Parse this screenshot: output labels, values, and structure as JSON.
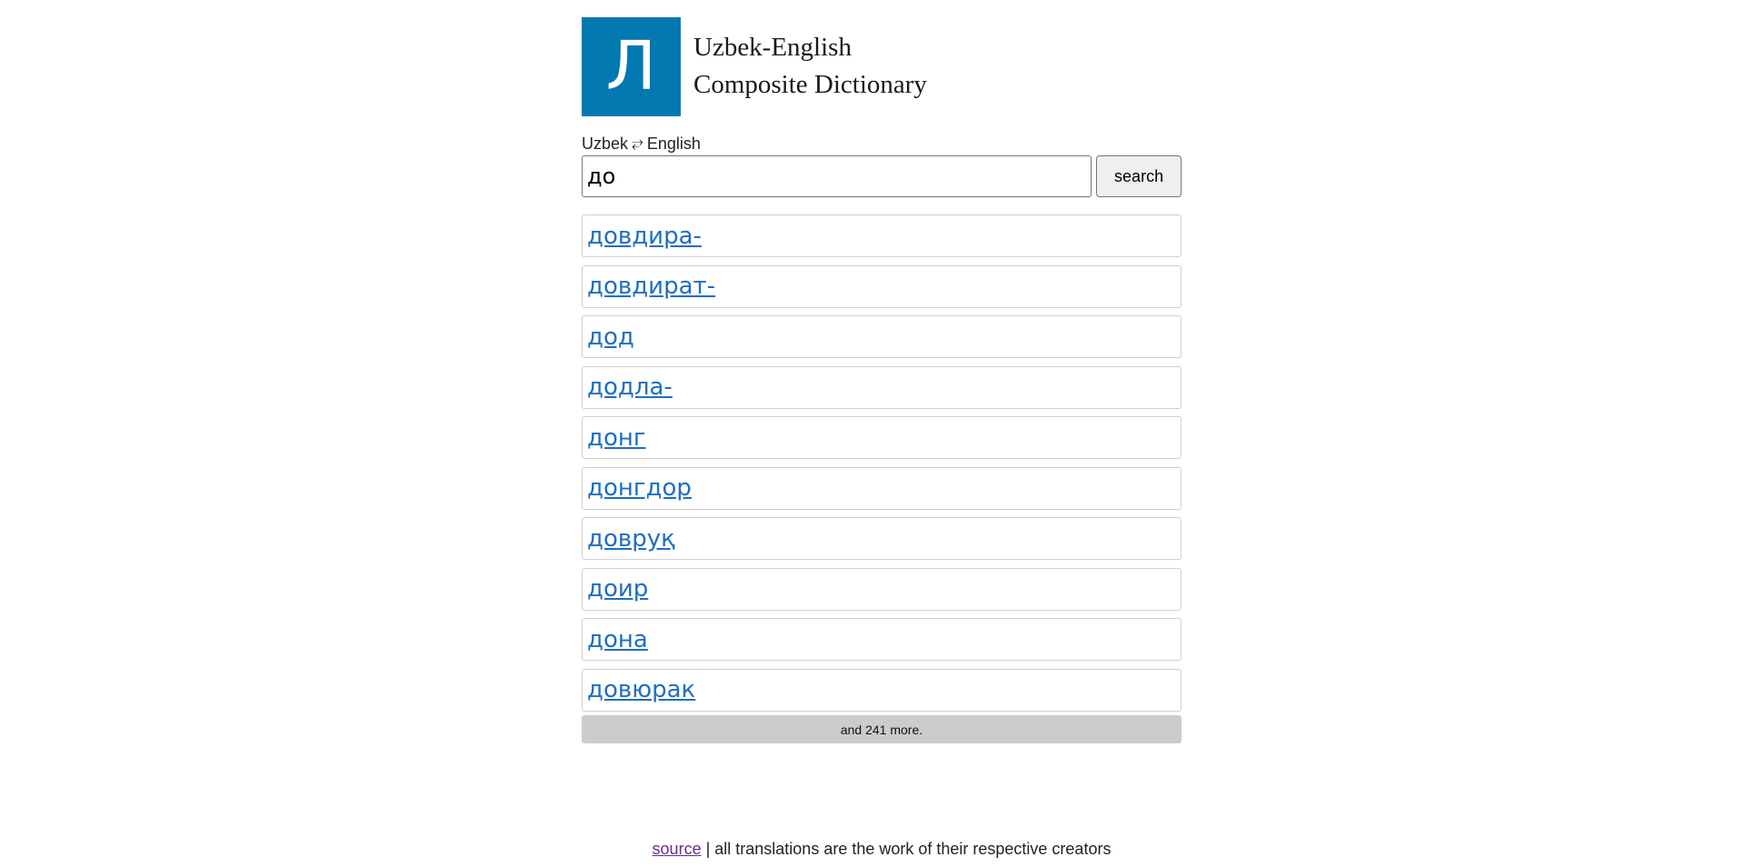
{
  "header": {
    "logo_glyph": "Л",
    "title_line1": "Uzbek-English",
    "title_line2": "Composite Dictionary",
    "brand_color": "#0279b1"
  },
  "lang_toggle": {
    "from": "Uzbek",
    "swap_icon": "⥂",
    "to": "English"
  },
  "search": {
    "value": "до",
    "button_label": "search"
  },
  "results": [
    {
      "word": "довдира-"
    },
    {
      "word": "довдират-"
    },
    {
      "word": "дод"
    },
    {
      "word": "додла-"
    },
    {
      "word": "донг"
    },
    {
      "word": "донгдор"
    },
    {
      "word": "довруқ"
    },
    {
      "word": "доир"
    },
    {
      "word": "дона"
    },
    {
      "word": "довюрак"
    }
  ],
  "more_text": "and 241 more.",
  "footer": {
    "source_link": "source",
    "text": " | all translations are the work of their respective creators"
  }
}
